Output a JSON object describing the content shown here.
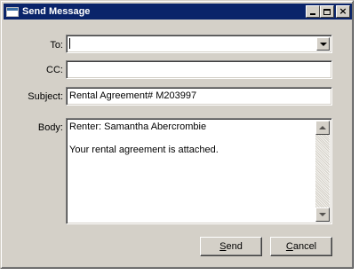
{
  "window": {
    "title": "Send Message"
  },
  "fields": {
    "to": {
      "label": "To:",
      "value": ""
    },
    "cc": {
      "label": "CC:",
      "value": ""
    },
    "subject": {
      "label": "Subject:",
      "value": "Rental Agreement# M203997"
    },
    "body": {
      "label": "Body:",
      "line1": "Renter: Samantha Abercrombie",
      "line2": "Your rental agreement is attached."
    }
  },
  "buttons": {
    "send": {
      "accel": "S",
      "rest": "end"
    },
    "cancel": {
      "accel": "C",
      "rest": "ancel"
    }
  }
}
